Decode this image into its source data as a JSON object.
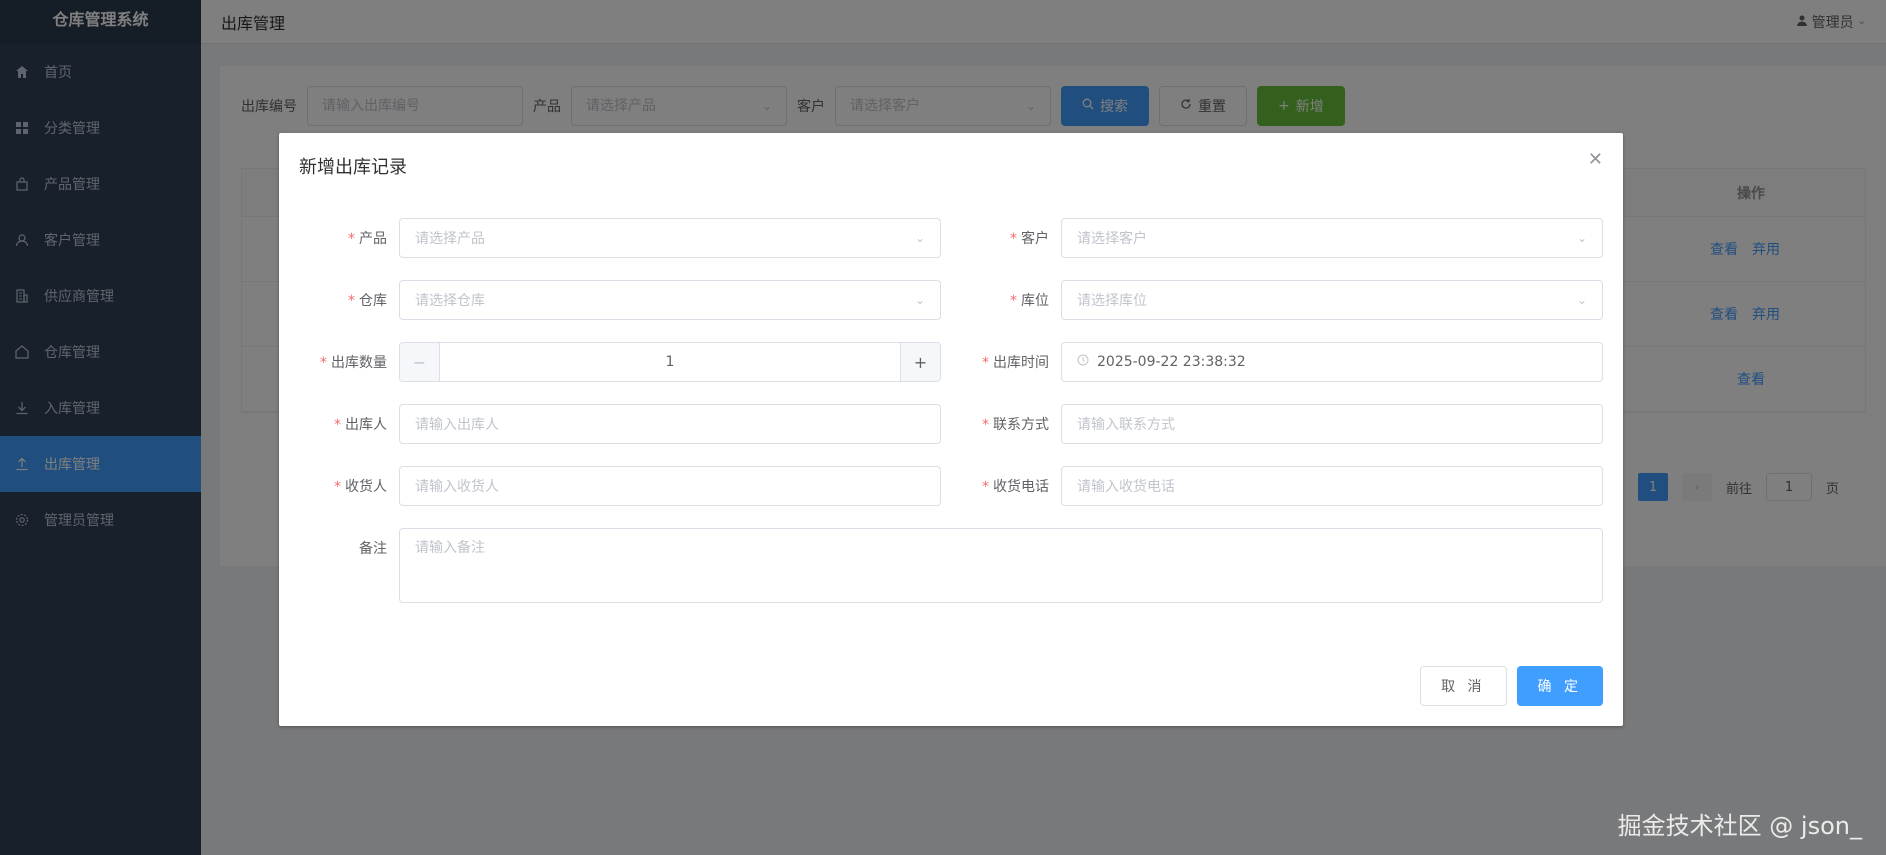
{
  "app": {
    "title": "仓库管理系统"
  },
  "sidebar": {
    "items": [
      {
        "label": "首页",
        "icon": "home-icon"
      },
      {
        "label": "分类管理",
        "icon": "grid-icon"
      },
      {
        "label": "产品管理",
        "icon": "bag-icon"
      },
      {
        "label": "客户管理",
        "icon": "user-icon"
      },
      {
        "label": "供应商管理",
        "icon": "building-icon"
      },
      {
        "label": "仓库管理",
        "icon": "warehouse-icon"
      },
      {
        "label": "入库管理",
        "icon": "download-icon"
      },
      {
        "label": "出库管理",
        "icon": "upload-icon",
        "active": true
      },
      {
        "label": "管理员管理",
        "icon": "gear-icon"
      }
    ]
  },
  "header": {
    "title": "出库管理",
    "user": "管理员"
  },
  "search": {
    "code_label": "出库编号",
    "code_placeholder": "请输入出库编号",
    "product_label": "产品",
    "product_placeholder": "请选择产品",
    "customer_label": "客户",
    "customer_placeholder": "请选择客户",
    "search_btn": "搜索",
    "reset_btn": "重置",
    "add_btn": "新增"
  },
  "table": {
    "op_header": "操作",
    "rows": [
      {
        "ops": [
          "查看",
          "弃用"
        ]
      },
      {
        "ops": [
          "查看",
          "弃用"
        ]
      },
      {
        "ops": [
          "查看"
        ]
      }
    ]
  },
  "pagination": {
    "current": "1",
    "goto_label": "前往",
    "goto_value": "1",
    "page_suffix": "页"
  },
  "dialog": {
    "title": "新增出库记录",
    "fields": {
      "product": {
        "label": "产品",
        "placeholder": "请选择产品"
      },
      "customer": {
        "label": "客户",
        "placeholder": "请选择客户"
      },
      "warehouse": {
        "label": "仓库",
        "placeholder": "请选择仓库"
      },
      "location": {
        "label": "库位",
        "placeholder": "请选择库位"
      },
      "quantity": {
        "label": "出库数量",
        "value": "1"
      },
      "time": {
        "label": "出库时间",
        "value": "2025-09-22 23:38:32"
      },
      "operator": {
        "label": "出库人",
        "placeholder": "请输入出库人"
      },
      "contact": {
        "label": "联系方式",
        "placeholder": "请输入联系方式"
      },
      "receiver": {
        "label": "收货人",
        "placeholder": "请输入收货人"
      },
      "receiver_phone": {
        "label": "收货电话",
        "placeholder": "请输入收货电话"
      },
      "remark": {
        "label": "备注",
        "placeholder": "请输入备注"
      }
    },
    "cancel_btn": "取 消",
    "ok_btn": "确 定"
  },
  "watermark": "掘金技术社区 @ json_",
  "colors": {
    "sidebar_bg": "#304156",
    "primary": "#409eff",
    "success": "#67c23a",
    "required": "#f56c6c"
  }
}
